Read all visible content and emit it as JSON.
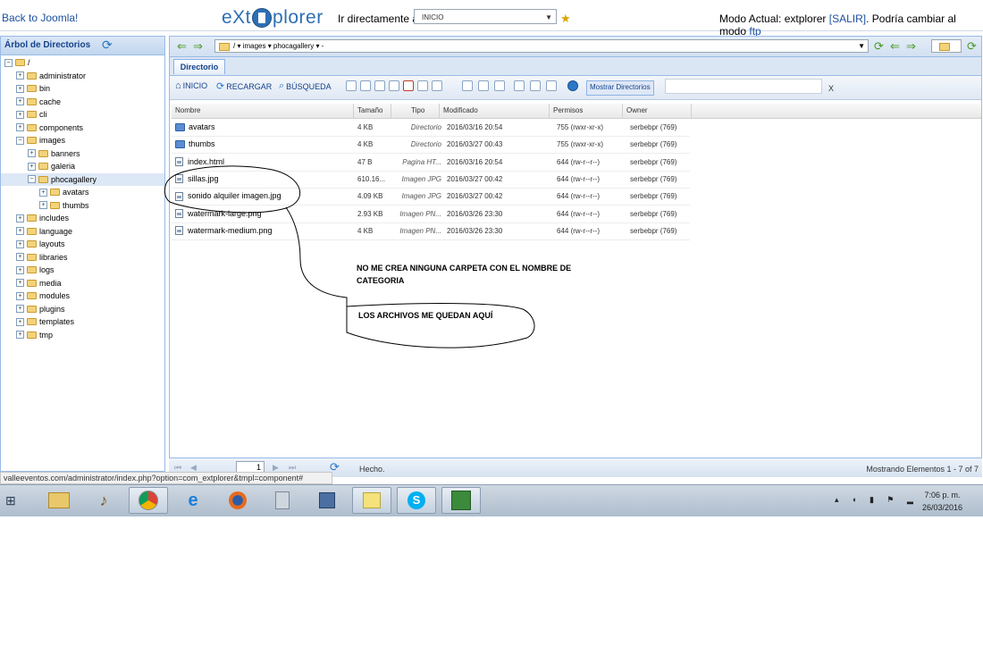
{
  "topbar": {
    "back_link": "Back to Joomla!",
    "logo_left": "eXt",
    "logo_right": "plorer",
    "goto_label": "Ir directamente a:",
    "goto_value": "INICIO",
    "mode_prefix": "Modo Actual: extplorer",
    "mode_exit": "[SALIR]",
    "mode_suffix": ". Podría cambiar al modo",
    "mode_ftp": "ftp"
  },
  "tree": {
    "title": "Árbol de Directorios",
    "items": [
      {
        "label": "/",
        "pm": "−",
        "open": true
      },
      {
        "label": "administrator",
        "pm": "+"
      },
      {
        "label": "bin",
        "pm": "+"
      },
      {
        "label": "cache",
        "pm": "+"
      },
      {
        "label": "cli",
        "pm": "+"
      },
      {
        "label": "components",
        "pm": "+"
      },
      {
        "label": "images",
        "pm": "−",
        "open": true
      },
      {
        "label": "banners",
        "pm": "+"
      },
      {
        "label": "galeria",
        "pm": "+"
      },
      {
        "label": "phocagallery",
        "pm": "−",
        "open": true,
        "selected": true
      },
      {
        "label": "avatars",
        "pm": "+"
      },
      {
        "label": "thumbs",
        "pm": "+"
      },
      {
        "label": "includes",
        "pm": "+"
      },
      {
        "label": "language",
        "pm": "+"
      },
      {
        "label": "layouts",
        "pm": "+"
      },
      {
        "label": "libraries",
        "pm": "+"
      },
      {
        "label": "logs",
        "pm": "+"
      },
      {
        "label": "media",
        "pm": "+"
      },
      {
        "label": "modules",
        "pm": "+"
      },
      {
        "label": "plugins",
        "pm": "+"
      },
      {
        "label": "templates",
        "pm": "+"
      },
      {
        "label": "tmp",
        "pm": "+"
      }
    ]
  },
  "path": {
    "text": "/ ▾  images ▾  phocagallery ▾  -"
  },
  "tabs": {
    "directory": "Directorio"
  },
  "toolbar": {
    "home": "INICIO",
    "reload": "RECARGAR",
    "search": "BÚSQUEDA",
    "show_dirs": "Mostrar Directorios",
    "clear": "X"
  },
  "grid": {
    "headers": [
      "Nombre",
      "Tamaño",
      "Tipo",
      "Modificado",
      "Permisos",
      "Owner"
    ],
    "rows": [
      {
        "name": "avatars",
        "size": "4 KB",
        "type": "Directorio",
        "modified": "2016/03/16 20:54",
        "perms": "755 (rwxr-xr-x)",
        "owner": "serbebpr (769)",
        "kind": "dir"
      },
      {
        "name": "thumbs",
        "size": "4 KB",
        "type": "Directorio",
        "modified": "2016/03/27 00:43",
        "perms": "755 (rwxr-xr-x)",
        "owner": "serbebpr (769)",
        "kind": "dir"
      },
      {
        "name": "index.html",
        "size": "47 B",
        "type": "Pagina HT...",
        "modified": "2016/03/16 20:54",
        "perms": "644 (rw-r--r--)",
        "owner": "serbebpr (769)",
        "kind": "file"
      },
      {
        "name": "sillas.jpg",
        "size": "610.16...",
        "type": "Imagen JPG",
        "modified": "2016/03/27 00:42",
        "perms": "644 (rw-r--r--)",
        "owner": "serbebpr (769)",
        "kind": "file"
      },
      {
        "name": "sonido alquiler imagen.jpg",
        "size": "4.09 KB",
        "type": "Imagen JPG",
        "modified": "2016/03/27 00:42",
        "perms": "644 (rw-r--r--)",
        "owner": "serbebpr (769)",
        "kind": "file"
      },
      {
        "name": "watermark-large.png",
        "size": "2.93 KB",
        "type": "Imagen PN...",
        "modified": "2016/03/26 23:30",
        "perms": "644 (rw-r--r--)",
        "owner": "serbebpr (769)",
        "kind": "file"
      },
      {
        "name": "watermark-medium.png",
        "size": "4 KB",
        "type": "Imagen PN...",
        "modified": "2016/03/26 23:30",
        "perms": "644 (rw-r--r--)",
        "owner": "serbebpr (769)",
        "kind": "file"
      }
    ]
  },
  "paging": {
    "page": "1",
    "status": "Hecho.",
    "count": "Mostrando Elementos 1 - 7 of 7"
  },
  "url_tooltip": "valleeventos.com/administrator/index.php?option=com_extplorer&tmpl=component#",
  "annotations": {
    "line1": "NO ME CREA NINGUNA CARPETA CON EL NOMBRE DE CATEGORIA",
    "line2": "LOS ARCHIVOS ME QUEDAN AQUÍ"
  },
  "clock": {
    "time": "7:06 p. m.",
    "date": "26/03/2016"
  },
  "colors": {
    "accent": "#15428b",
    "link": "#1c50a0",
    "panel_border": "#99bbe8"
  }
}
